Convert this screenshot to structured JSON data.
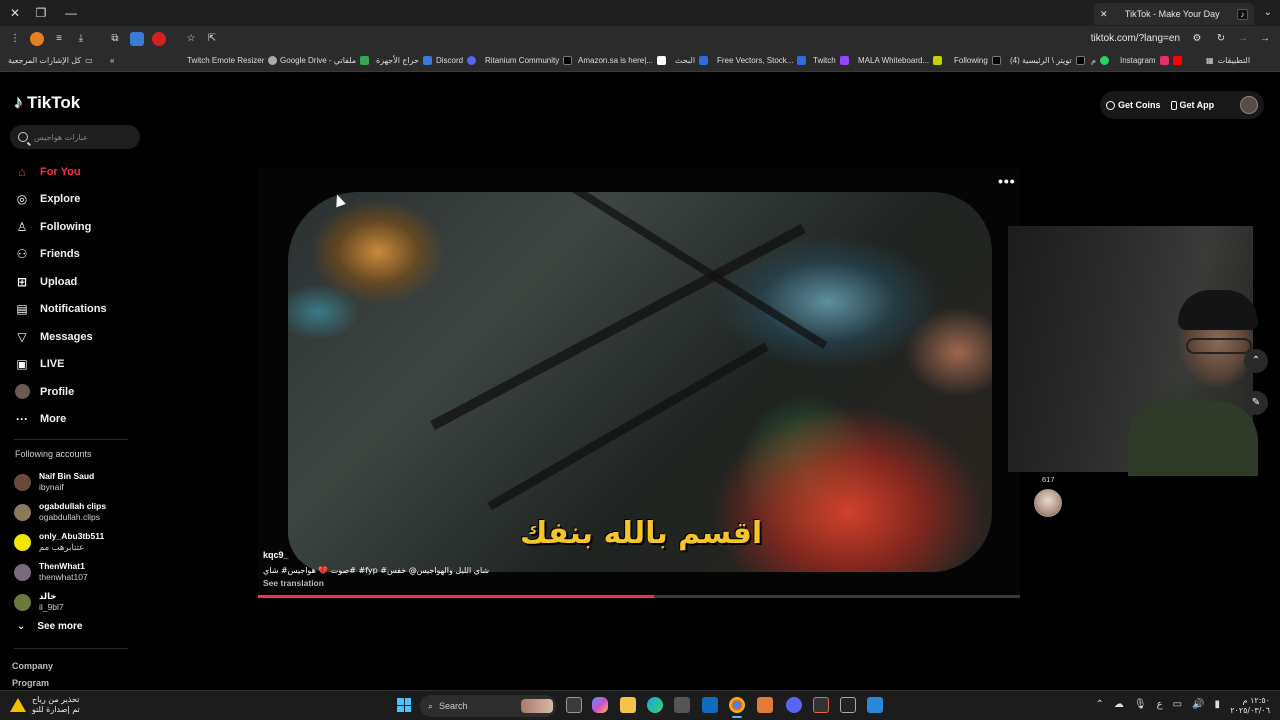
{
  "browser": {
    "tab_title": "TikTok - Make Your Day",
    "url": "tiktok.com/?lang=en",
    "bookmarks_right": [
      "Twitch Emote Resizer",
      "Google Drive - ملفاتي",
      "حراج الأجهزة",
      "Discord",
      "Ritanium Community",
      "Amazon.sa is here|...",
      "البحث",
      "Free Vectors, Stock...",
      "Twitch",
      "MALA Whiteboard...",
      "Following",
      "(4) تويتر \\ الرئيسية",
      "م",
      "Instagram"
    ],
    "bookmarks_left": "كل الإشارات المرجعية",
    "apps_label": "التطبيقات"
  },
  "tiktok": {
    "logo": "TikTok",
    "search_placeholder": "عبارات هواجيس",
    "nav": [
      {
        "label": "For You",
        "icon": "home-icon",
        "active": true
      },
      {
        "label": "Explore",
        "icon": "compass-icon",
        "active": false
      },
      {
        "label": "Following",
        "icon": "following-icon",
        "active": false
      },
      {
        "label": "Friends",
        "icon": "friends-icon",
        "active": false
      },
      {
        "label": "Upload",
        "icon": "upload-icon",
        "active": false
      },
      {
        "label": "Notifications",
        "icon": "notifications-icon",
        "active": false
      },
      {
        "label": "Messages",
        "icon": "messages-icon",
        "active": false
      },
      {
        "label": "LIVE",
        "icon": "live-icon",
        "active": false
      },
      {
        "label": "Profile",
        "icon": "profile-icon",
        "active": false
      },
      {
        "label": "More",
        "icon": "more-icon",
        "active": false
      }
    ],
    "following_accounts_title": "Following accounts",
    "following_accounts": [
      {
        "name": "Naif Bin Saud",
        "handle": "ibynaif",
        "color": "#6b4a3a"
      },
      {
        "name": "ogabdullah clips",
        "handle": "ogabdullah.clips",
        "color": "#8a7a5a"
      },
      {
        "name": "only_Abu3tb511",
        "handle": "عتتابرهب مم",
        "color": "#f2e600"
      },
      {
        "name": "ThenWhat1",
        "handle": "thenwhat107",
        "color": "#7a6a7a"
      },
      {
        "name": "خالد",
        "handle": "il_9bl7",
        "color": "#6a7a3a"
      }
    ],
    "see_more": "See more",
    "footer": [
      "Company",
      "Program"
    ],
    "top_right": {
      "get_coins": "Get Coins",
      "get_app": "Get App"
    },
    "video": {
      "more_label": "•••",
      "subtitle": "اقسم بالله بنفك",
      "username": "kqc9_",
      "caption": "صوت 💔 هواجيس#  شاي#  #fyp  #شاي الليل والهواجيس@ خفس",
      "see_translation": "See translation",
      "progress": 0.52
    },
    "side": {
      "likes": "617"
    }
  },
  "taskbar": {
    "weather_line1": "تحذير من رياح",
    "weather_line2": "تم إصدارة للتو",
    "search": "Search",
    "clock_time": "١٢:٥٠ م",
    "clock_date": "٢٠٢٥/٠٣/٠٦",
    "lang": "ع"
  }
}
